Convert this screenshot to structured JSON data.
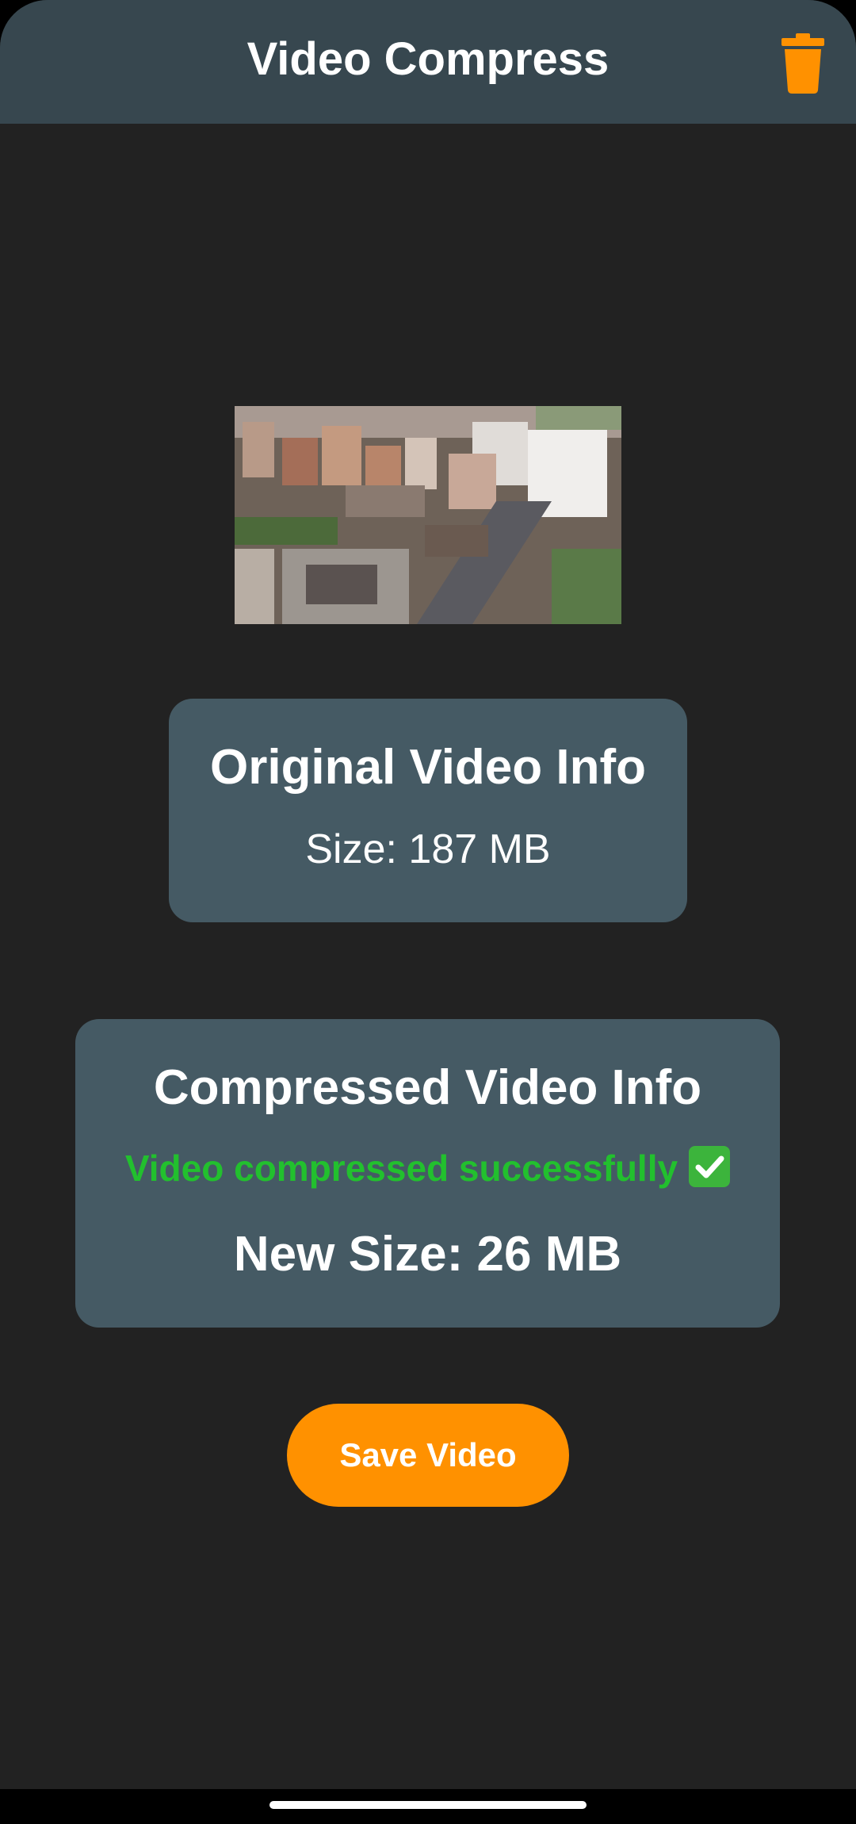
{
  "app_bar": {
    "title": "Video Compress",
    "action_icon": "trash-icon",
    "accent_color": "#ff9100"
  },
  "original_info": {
    "title": "Original Video Info",
    "size_text": "Size: 187 MB"
  },
  "compressed_info": {
    "title": "Compressed Video Info",
    "status_text": "Video compressed successfully",
    "status_icon": "check-mark-icon",
    "status_color": "#22c02e",
    "new_size_text": "New Size: 26 MB"
  },
  "actions": {
    "save_label": "Save Video"
  }
}
